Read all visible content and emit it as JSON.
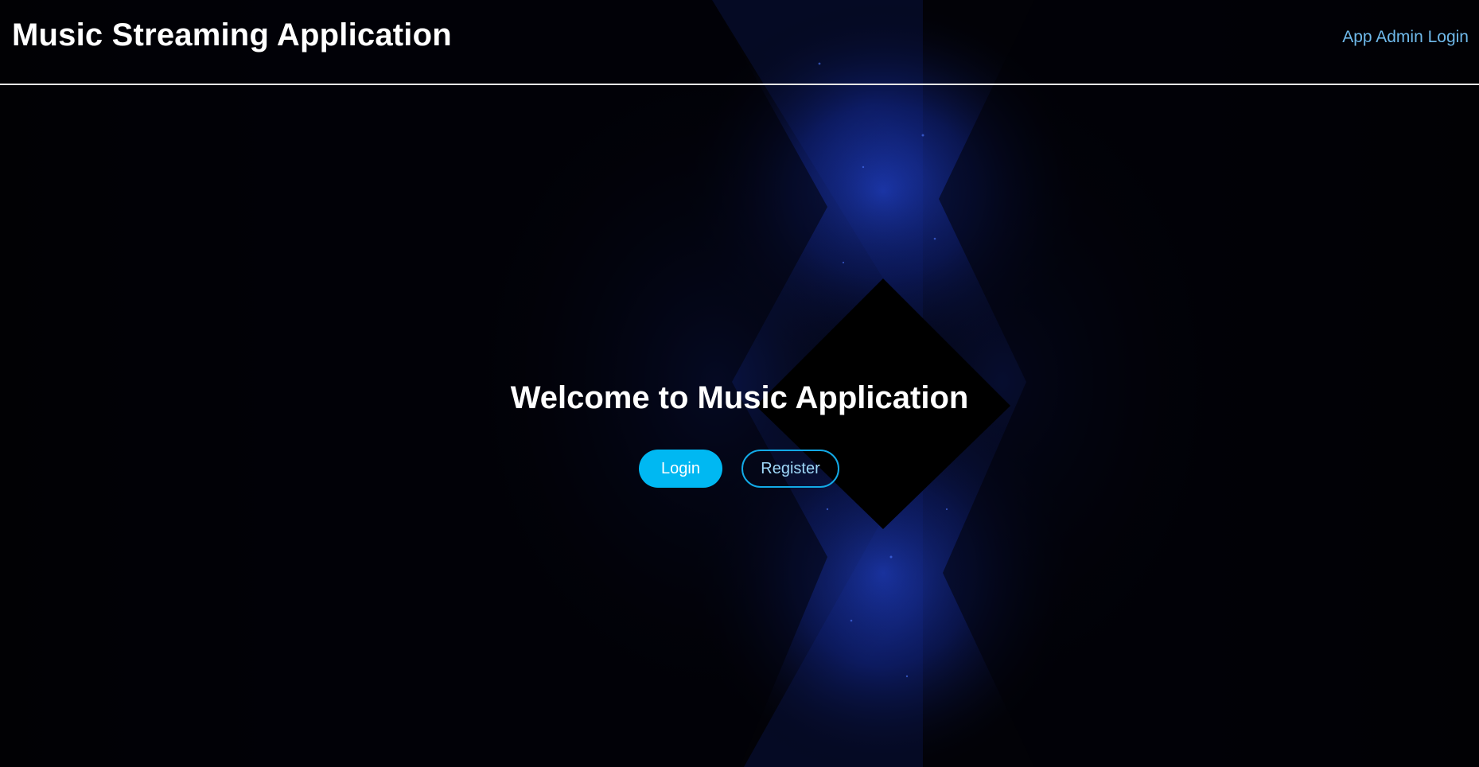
{
  "header": {
    "brand_title": "Music Streaming Application",
    "admin_login_link": "App Admin Login"
  },
  "hero": {
    "welcome_heading": "Welcome to Music Application",
    "login_button": "Login",
    "register_button": "Register"
  },
  "colors": {
    "background": "#020207",
    "primary_button": "#00b8f2",
    "outline_button_border": "#12a9e6",
    "link": "#6fb9ea",
    "glow": "#1f3fd6"
  }
}
